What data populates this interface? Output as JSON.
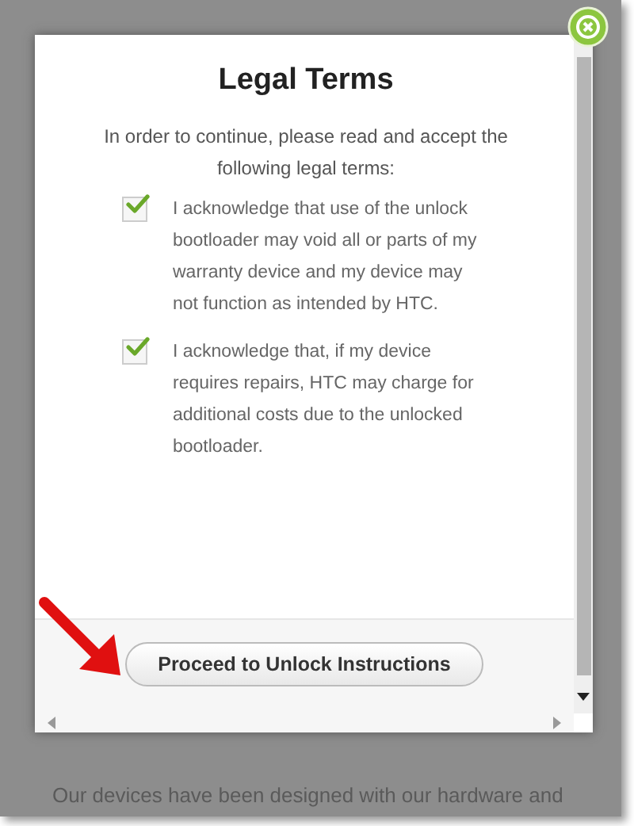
{
  "background_page": {
    "bottom_line": "Our devices have been designed with our hardware and"
  },
  "dialog": {
    "title": "Legal Terms",
    "intro": "In order to continue, please read and accept the following legal terms:",
    "terms": [
      {
        "text": "I acknowledge that use of the unlock bootloader may void all or parts of my warranty device and my device may not function as intended by HTC.",
        "checked": true
      },
      {
        "text": "I acknowledge that, if my device requires repairs, HTC may charge for additional costs due to the unlocked bootloader.",
        "checked": true
      }
    ],
    "button": "Proceed to Unlock Instructions"
  }
}
